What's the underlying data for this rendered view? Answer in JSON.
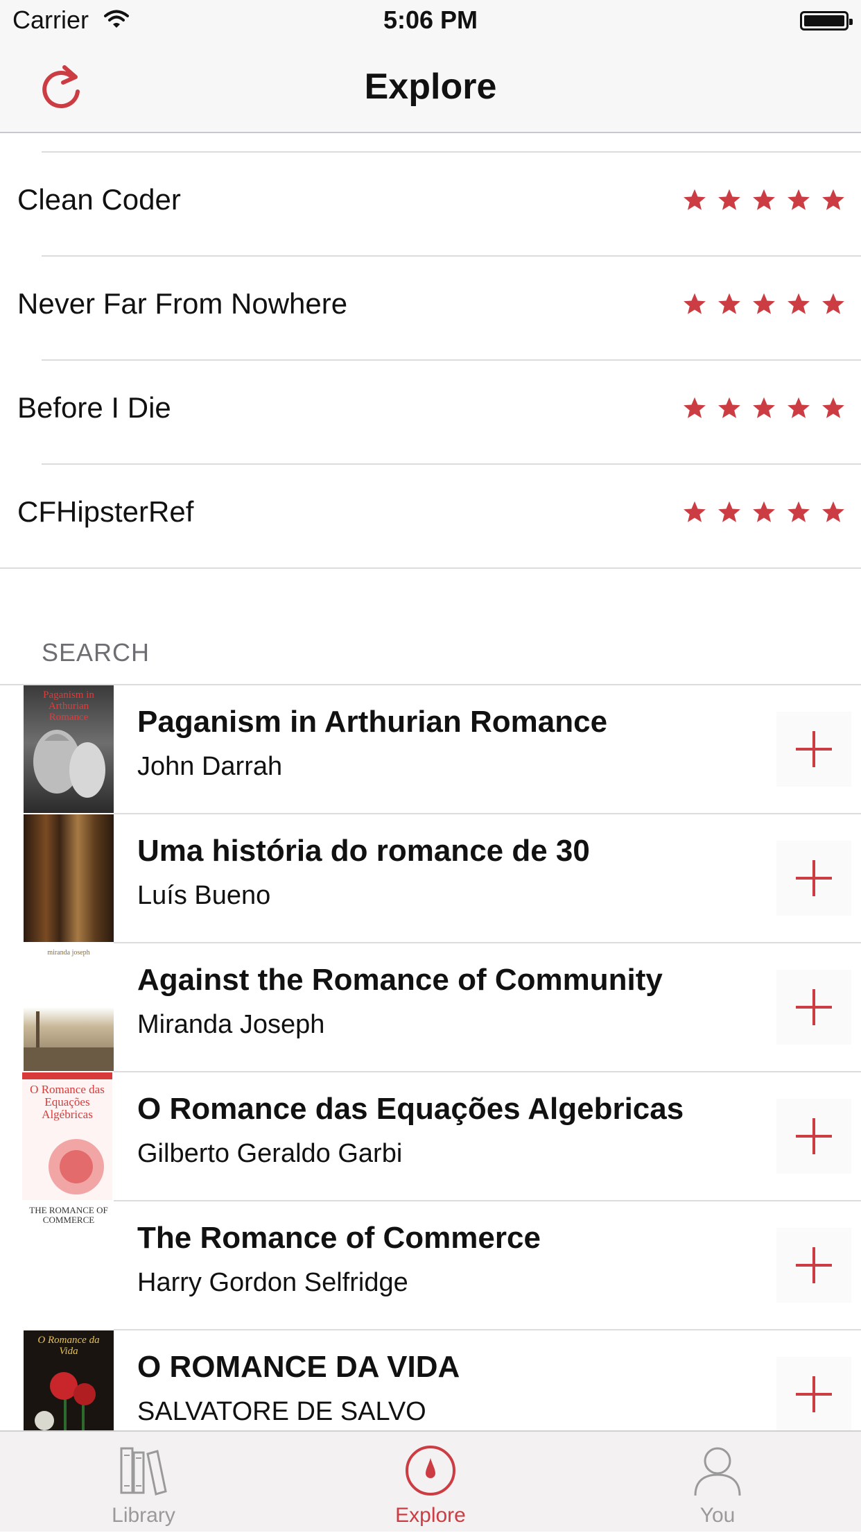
{
  "status_bar": {
    "carrier": "Carrier",
    "time": "5:06 PM"
  },
  "nav": {
    "title": "Explore"
  },
  "rated_books": [
    {
      "title": "Clean Coder",
      "rating": 5
    },
    {
      "title": "Never Far From Nowhere",
      "rating": 5
    },
    {
      "title": "Before I Die",
      "rating": 5
    },
    {
      "title": "CFHipsterRef",
      "rating": 5
    }
  ],
  "search": {
    "header": "SEARCH",
    "results": [
      {
        "title": "Paganism in Arthurian Romance",
        "author": "John Darrah",
        "cover_text": "Paganism in Arthurian Romance"
      },
      {
        "title": "Uma história do romance de 30",
        "author": "Luís Bueno",
        "cover_text": ""
      },
      {
        "title": "Against the Romance of Community",
        "author": "Miranda Joseph",
        "cover_text": "miranda joseph"
      },
      {
        "title": "O Romance das Equações Algebricas",
        "author": "Gilberto Geraldo Garbi",
        "cover_text": "O Romance das Equações Algébricas"
      },
      {
        "title": "The Romance of Commerce",
        "author": "Harry Gordon Selfridge",
        "cover_text": "THE ROMANCE OF COMMERCE"
      },
      {
        "title": "O ROMANCE DA VIDA",
        "author": "SALVATORE DE SALVO",
        "cover_text": "O Romance da Vida"
      }
    ]
  },
  "tabs": [
    {
      "label": "Library",
      "icon": "library-icon",
      "active": false
    },
    {
      "label": "Explore",
      "icon": "explore-icon",
      "active": true
    },
    {
      "label": "You",
      "icon": "person-icon",
      "active": false
    }
  ],
  "colors": {
    "accent": "#cc3d43",
    "separator": "#dcdcdc",
    "bar_background": "#f7f7f7"
  }
}
